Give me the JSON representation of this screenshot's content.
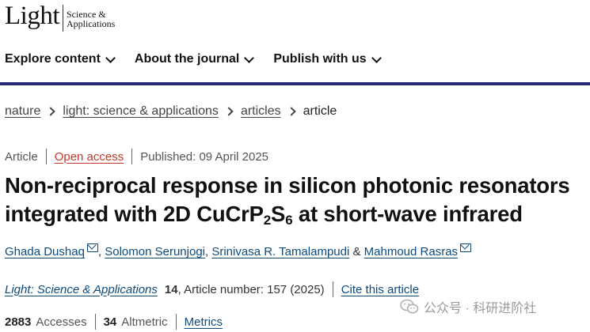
{
  "logo": {
    "main": "Light",
    "sub_line1": "Science &",
    "sub_line2": "Applications"
  },
  "nav": {
    "items": [
      {
        "label": "Explore content"
      },
      {
        "label": "About the journal"
      },
      {
        "label": "Publish with us"
      }
    ]
  },
  "breadcrumb": {
    "items": [
      "nature",
      "light: science & applications",
      "articles"
    ],
    "current": "article"
  },
  "meta": {
    "type": "Article",
    "access": "Open access",
    "published": "Published: 09 April 2025"
  },
  "title": {
    "line1": "Non-reciprocal response in silicon photonic resonators",
    "line2_prefix": "integrated with 2D CuCrP",
    "sub1": "2",
    "mid": "S",
    "sub2": "6",
    "suffix": " at short-wave infrared"
  },
  "authors": {
    "list": [
      {
        "name": "Ghada Dushaq",
        "email": true
      },
      {
        "name": "Solomon Serunjogi",
        "email": false
      },
      {
        "name": "Srinivasa R. Tamalampudi",
        "email": false
      },
      {
        "name": "Mahmoud Rasras",
        "email": true
      }
    ],
    "sep1": ", ",
    "sep2": ", ",
    "amp": " & "
  },
  "citation": {
    "journal": "Light: Science & Applications",
    "volume": "14",
    "article_number": ", Article number: 157 (2025)",
    "cite_label": "Cite this article"
  },
  "metrics": {
    "accesses_count": "2883",
    "accesses_label": "Accesses",
    "altmetric_count": "34",
    "altmetric_label": "Altmetric",
    "metrics_label": "Metrics"
  },
  "watermark": {
    "text": "公众号 · 科研进阶社"
  },
  "colors": {
    "nav_rule": "#29297a",
    "link": "#0c4a7e",
    "open_access": "#c0392b"
  }
}
